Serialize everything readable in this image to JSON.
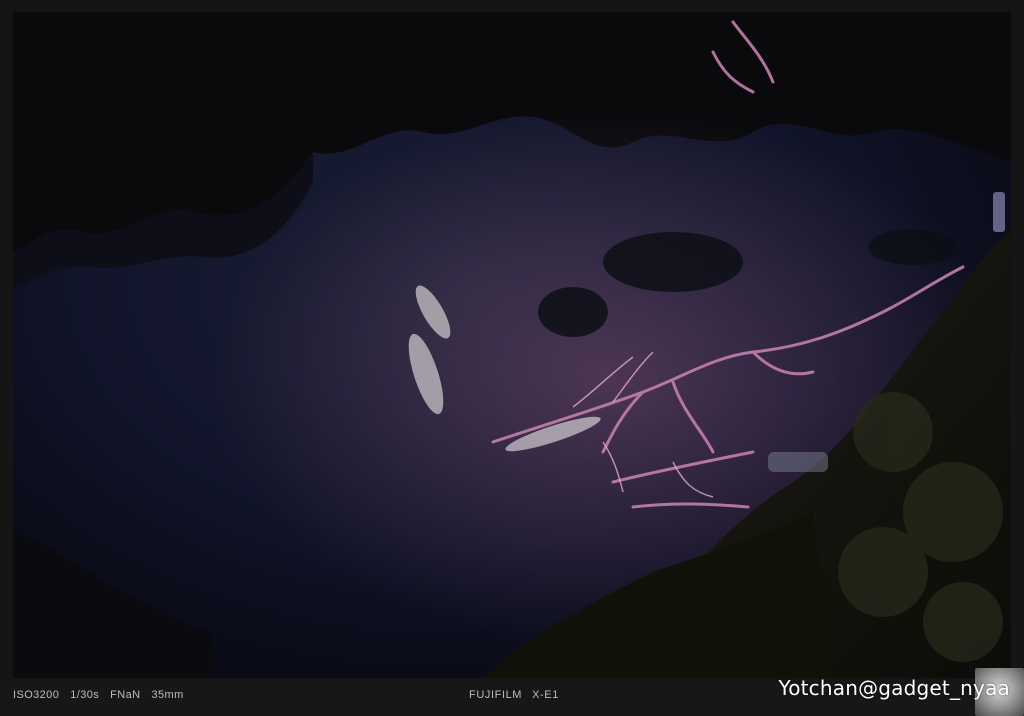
{
  "photo": {
    "description_icon": "night-koi-pond-photo"
  },
  "exif": {
    "iso": "ISO3200",
    "shutter": "1/30s",
    "aperture": "FNaN",
    "focal_length": "35mm",
    "camera_brand": "FUJIFILM",
    "camera_model": "X-E1"
  },
  "watermark": {
    "text": "Yotchan@gadget_nyaa"
  },
  "colors": {
    "frame": "#151515",
    "water": "#0b0c16",
    "highlight_branch": "#c87aa8",
    "text": "#bdbdbd"
  }
}
